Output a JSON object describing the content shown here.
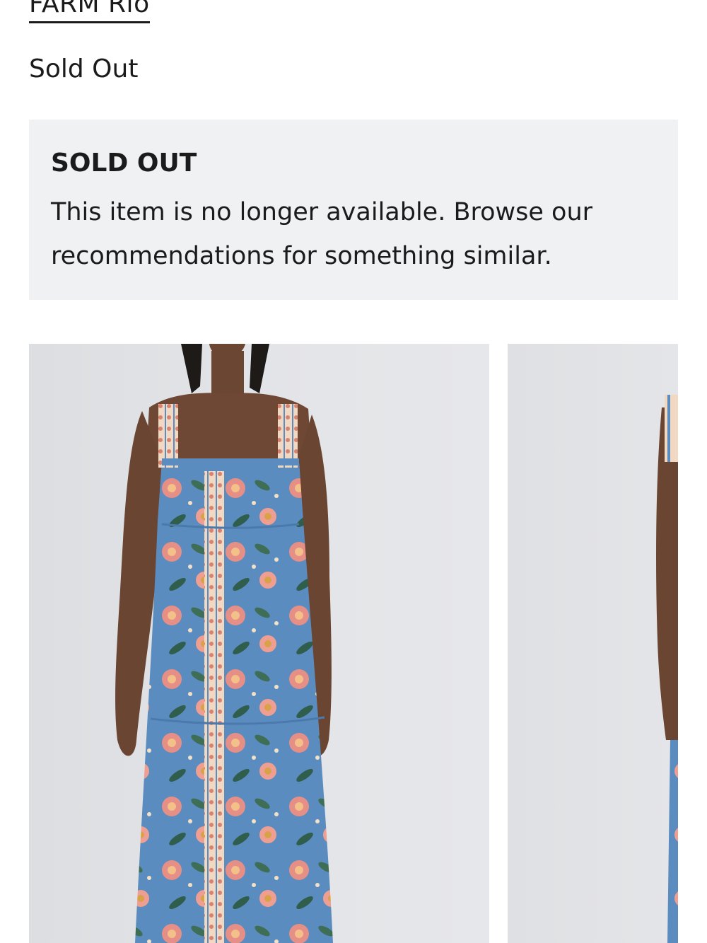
{
  "product": {
    "brand": "FARM Rio",
    "status": "Sold Out"
  },
  "notice": {
    "title": "SOLD OUT",
    "message": "This item is no longer available. Browse our recommendations for something similar."
  },
  "gallery": {
    "images": [
      {
        "description_label": "product-photo-front"
      },
      {
        "description_label": "product-photo-side"
      }
    ]
  },
  "colors": {
    "text": "#1b1b1b",
    "notice_background": "#f0f1f3",
    "dress_blue": "#5b8cc0",
    "flower_pink": "#e58f86"
  }
}
